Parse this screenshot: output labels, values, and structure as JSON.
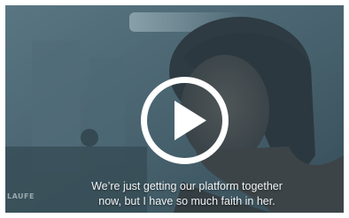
{
  "video": {
    "caption_lines": [
      "We’re just getting our platform together",
      "now, but I have so much faith in her."
    ],
    "watermark": "LAUFE",
    "play_icon": "play-circle-icon",
    "colors": {
      "overlay": "#405e6a",
      "caption": "#f1f4f5",
      "play": "#ffffff"
    }
  }
}
